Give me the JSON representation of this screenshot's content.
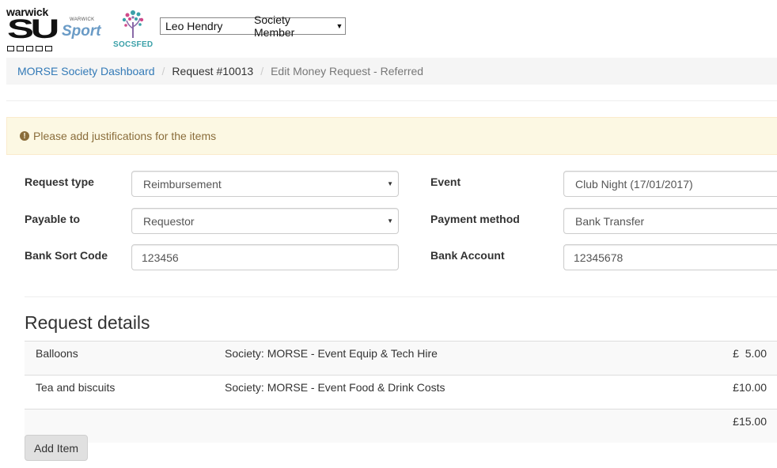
{
  "header": {
    "logo_su": {
      "word": "warwick",
      "mark": "SU"
    },
    "logo_sport": {
      "small": "WARWICK",
      "big": "Sport"
    },
    "logo_socsfed": {
      "text": "SOCSFED"
    },
    "user_select": {
      "name": "Leo Hendry",
      "role": "Society Member"
    }
  },
  "breadcrumb": {
    "home": "MORSE Society Dashboard",
    "request": "Request #10013",
    "current": "Edit Money Request - Referred",
    "separator": "/"
  },
  "alert": {
    "icon": "exclamation-circle-icon",
    "text": "Please add justifications for the items",
    "color": "#8a6d3b",
    "background": "#fcf8e3"
  },
  "form": {
    "request_type": {
      "label": "Request type",
      "value": "Reimbursement"
    },
    "event": {
      "label": "Event",
      "value": "Club Night (17/01/2017)"
    },
    "payable_to": {
      "label": "Payable to",
      "value": "Requestor"
    },
    "payment_method": {
      "label": "Payment method",
      "value": "Bank Transfer"
    },
    "bank_sort_code": {
      "label": "Bank Sort Code",
      "value": "123456"
    },
    "bank_account": {
      "label": "Bank Account",
      "value": "12345678"
    }
  },
  "details": {
    "heading": "Request details",
    "items": [
      {
        "name": "Balloons",
        "budget": "Society: MORSE - Event Equip & Tech Hire",
        "amount": "£  5.00"
      },
      {
        "name": "Tea and biscuits",
        "budget": "Society: MORSE - Event Food & Drink Costs",
        "amount": "£10.00"
      }
    ],
    "total": "£15.00"
  },
  "actions": {
    "add_item": "Add Item"
  },
  "colors": {
    "link": "#337ab7",
    "breadcrumb_bg": "#f5f5f5",
    "sport_blue": "#6a9bc6",
    "socsfed_teal": "#3aa0a8"
  }
}
